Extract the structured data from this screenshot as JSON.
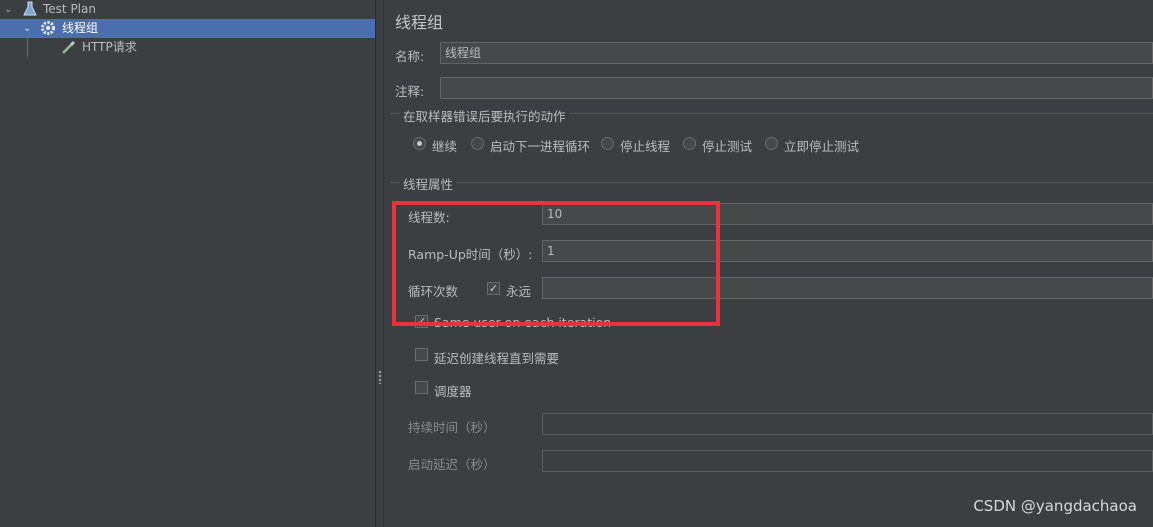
{
  "tree": {
    "items": [
      {
        "label": "Test Plan",
        "icon": "flask-icon",
        "expanded": true,
        "selected": false
      },
      {
        "label": "线程组",
        "icon": "gear-icon",
        "expanded": true,
        "selected": true
      },
      {
        "label": "HTTP请求",
        "icon": "pipette-icon",
        "selected": false
      }
    ]
  },
  "panel": {
    "title": "线程组",
    "name_label": "名称:",
    "name_value": "线程组",
    "comment_label": "注释:",
    "comment_value": "",
    "error_group_title": "在取样器错误后要执行的动作",
    "error_actions": [
      {
        "label": "继续",
        "selected": true
      },
      {
        "label": "启动下一进程循环",
        "selected": false
      },
      {
        "label": "停止线程",
        "selected": false
      },
      {
        "label": "停止测试",
        "selected": false
      },
      {
        "label": "立即停止测试",
        "selected": false
      }
    ],
    "thread_group_title": "线程属性",
    "threads_label": "线程数:",
    "threads_value": "10",
    "rampup_label": "Ramp-Up时间（秒）:",
    "rampup_value": "1",
    "loop_label": "循环次数",
    "forever_label": "永远",
    "forever_checked": true,
    "loop_value": "",
    "same_user_label": "Same user on each iteration",
    "same_user_checked": true,
    "delay_label": "延迟创建线程直到需要",
    "delay_checked": false,
    "scheduler_label": "调度器",
    "scheduler_checked": false,
    "duration_label": "持续时间（秒）",
    "duration_value": "",
    "startup_delay_label": "启动延迟（秒）",
    "startup_delay_value": ""
  },
  "colors": {
    "background": "#3c3f41",
    "selection": "#4b6eaf",
    "highlight_box": "#e8333a"
  },
  "watermark": "CSDN @yangdachaoa"
}
